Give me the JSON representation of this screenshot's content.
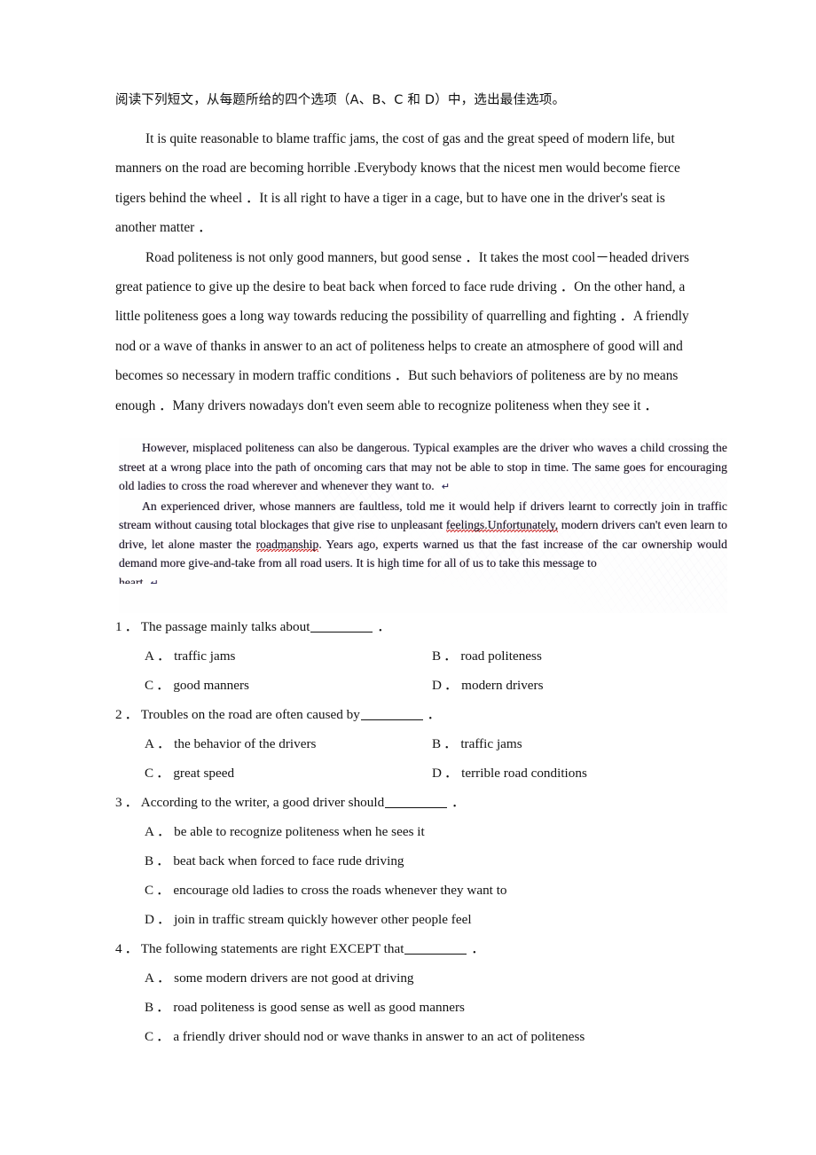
{
  "document": {
    "instruction": "阅读下列短文，从每题所给的四个选项（A、B、C 和 D）中，选出最佳选项。"
  },
  "passage": {
    "paragraphs": [
      "It is quite reasonable to blame traffic jams, the cost of gas and the great speed of modern life, but manners on the road are becoming horrible .Everybody knows that the nicest men would become fierce tigers behind the wheel ．It is all right to have a tiger in a cage, but to have one in the driver's seat is another matter ．",
      "Road politeness is not only good manners, but good sense ．It takes the most cool－headed drivers great patience to give up the desire to beat back when forced to face rude driving ．On the other hand, a little politeness goes a long way towards reducing the possibility of quarrelling and fighting ．A friendly nod or a wave of thanks in answer to an act of politeness helps to create an atmosphere of good will and becomes so necessary in modern traffic conditions ．But such behaviors of politeness are by no means enough ．Many drivers nowadays don't even seem able to recognize politeness when they see it ．"
    ]
  },
  "scanned_block": {
    "paragraph1_part1": "However, misplaced politeness can also be dangerous.  Typical examples are the driver who waves a child crossing the street at a wrong place into the path of oncoming cars that may not be able to stop in time.  The same goes for encouraging old ladies to cross the road wherever and whenever they want to.",
    "paragraph1_pilcrow": "↵",
    "paragraph2_part1": "An experienced driver, whose manners are faultless, told me it would help if drivers learnt to correctly join in traffic stream without causing total blockages that give rise to unpleasant ",
    "paragraph2_spell1": "feelings.Unfortunately,",
    "paragraph2_part2": " modern drivers can't even learn to drive, let alone master the ",
    "paragraph2_spell2": "roadmanship",
    "paragraph2_part3": ".  Years ago, experts warned us that the fast increase of the car ownership would demand more give-and-take from all road users.  It is high time for all of us to take this message to",
    "paragraph2_lastline": "heart",
    "paragraph2_pilcrow": "↵"
  },
  "questions": [
    {
      "number": "1",
      "sep": "．",
      "stem_before": "The passage mainly talks about",
      "stem_after": "．",
      "options": [
        {
          "letter": "A",
          "sep": "．",
          "text": "traffic jams"
        },
        {
          "letter": "B",
          "sep": "．",
          "text": "road politeness"
        },
        {
          "letter": "C",
          "sep": "．",
          "text": "good manners"
        },
        {
          "letter": "D",
          "sep": "．",
          "text": "modern drivers"
        }
      ]
    },
    {
      "number": "2",
      "sep": "．",
      "stem_before": "Troubles on the road are often caused by",
      "stem_after": "．",
      "options": [
        {
          "letter": "A",
          "sep": "．",
          "text": "the behavior of the drivers"
        },
        {
          "letter": "B",
          "sep": "．",
          "text": "traffic jams"
        },
        {
          "letter": "C",
          "sep": "．",
          "text": "great speed"
        },
        {
          "letter": "D",
          "sep": "．",
          "text": "terrible road conditions"
        }
      ]
    },
    {
      "number": "3",
      "sep": "．",
      "stem_before": "According to the writer, a good driver should",
      "stem_after": "．",
      "options": [
        {
          "letter": "A",
          "sep": "．",
          "text": "be able to recognize politeness when he sees it"
        },
        {
          "letter": "B",
          "sep": "．",
          "text": "beat back when forced to face rude driving"
        },
        {
          "letter": "C",
          "sep": "．",
          "text": "encourage old ladies to cross the roads whenever they want to"
        },
        {
          "letter": "D",
          "sep": "．",
          "text": "join in traffic stream quickly however other people feel"
        }
      ]
    },
    {
      "number": "4",
      "sep": "．",
      "stem_before": "The following statements are right EXCEPT that",
      "stem_after": "．",
      "options": [
        {
          "letter": "A",
          "sep": "．",
          "text": "some modern drivers are not good at driving"
        },
        {
          "letter": "B",
          "sep": "．",
          "text": "road politeness is good sense as well as good manners"
        },
        {
          "letter": "C",
          "sep": "．",
          "text": "a friendly driver should nod or wave thanks in answer to an act of politeness"
        }
      ]
    }
  ]
}
